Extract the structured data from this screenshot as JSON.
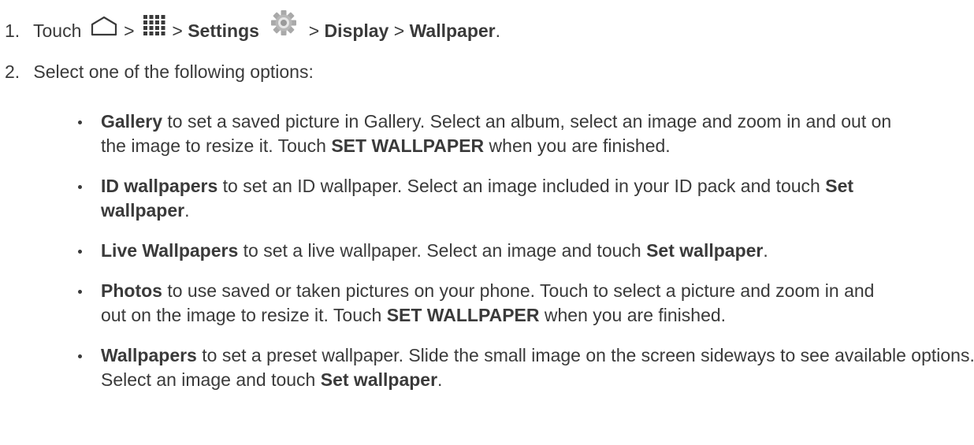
{
  "steps": [
    {
      "number": "1.",
      "text_touch": "Touch",
      "sep": ">",
      "settings": "Settings",
      "display": "Display",
      "wallpaper": "Wallpaper",
      "end": ".",
      "icons": [
        "home-icon",
        "apps-grid-icon",
        "settings-gear-icon"
      ]
    },
    {
      "number": "2.",
      "text": "Select one of the following options:"
    }
  ],
  "options": [
    {
      "name": "Gallery",
      "text1": " to set a saved picture in Gallery. Select an album, select an image and zoom in and out on the image to resize it. Touch ",
      "action": "SET WALLPAPER",
      "text2": " when you are finished."
    },
    {
      "name": "ID wallpapers",
      "text1": " to set an ID wallpaper. Select an image included in your ID pack and touch ",
      "action": "Set wallpaper",
      "text2": "."
    },
    {
      "name": "Live Wallpapers",
      "text1": " to set a live wallpaper. Select an image and touch ",
      "action": "Set wallpaper",
      "text2": "."
    },
    {
      "name": "Photos",
      "text1": " to use saved or taken pictures on your phone. Touch to select a picture and  zoom in and out on the image to resize it. Touch ",
      "action": "SET WALLPAPER",
      "text2": " when you are finished."
    },
    {
      "name": "Wallpapers",
      "text1": " to set a preset wallpaper. Slide the small image on the screen sideways to see available options. Select an image and touch ",
      "action": "Set wallpaper",
      "text2": "."
    }
  ]
}
